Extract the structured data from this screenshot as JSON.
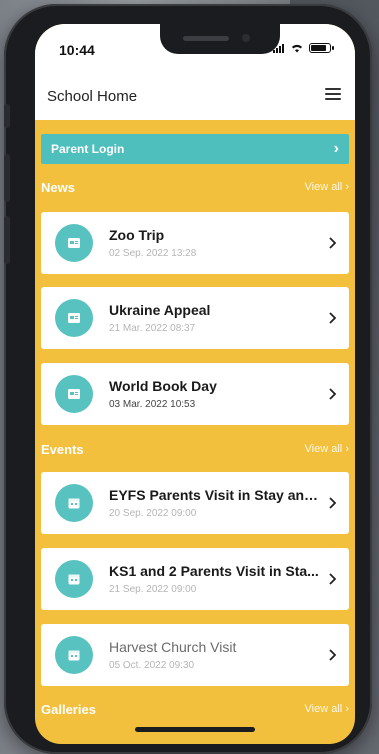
{
  "status": {
    "time": "10:44"
  },
  "header": {
    "title": "School Home",
    "menu_icon": "hamburger-menu-icon"
  },
  "parent_login": {
    "label": "Parent Login",
    "arrow": "›"
  },
  "sections": {
    "news": {
      "title": "News",
      "view_all": "View all"
    },
    "events": {
      "title": "Events",
      "view_all": "View all"
    },
    "galleries": {
      "title": "Galleries",
      "view_all": "View all"
    }
  },
  "news": [
    {
      "title": "Zoo Trip",
      "date": "02 Sep. 2022 13:28"
    },
    {
      "title": "Ukraine Appeal",
      "date": "21 Mar. 2022 08:37"
    },
    {
      "title": "World Book Day",
      "date": "03 Mar. 2022 10:53"
    }
  ],
  "events": [
    {
      "title": "EYFS Parents Visit in Stay and...",
      "date": "20 Sep. 2022 09:00"
    },
    {
      "title": "KS1 and 2 Parents Visit in Sta...",
      "date": "21 Sep. 2022 09:00"
    },
    {
      "title": "Harvest Church Visit",
      "date": "05 Oct. 2022 09:30"
    }
  ],
  "colors": {
    "accent_yellow": "#f2c03d",
    "teal": "#4ebfbd",
    "avatar_teal": "#58c2c0"
  }
}
